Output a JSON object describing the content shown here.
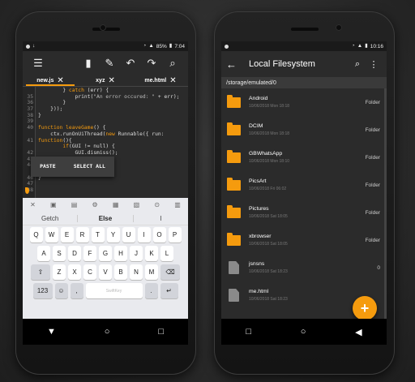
{
  "left": {
    "status": {
      "percent": "85%",
      "time": "7:04"
    },
    "tabs": [
      "new.js",
      "xyz",
      "me.html"
    ],
    "line_numbers": [
      "",
      "35",
      "36",
      "37",
      "38",
      "39",
      "40",
      "",
      "41",
      "",
      "42",
      "43",
      "44",
      "",
      "46",
      "47",
      "48"
    ],
    "code_lines": [
      "        } catch (err) {",
      "            print(\"An error occured: \" + err);",
      "        }",
      "    }));",
      "}",
      "",
      "function leaveGame() {",
      "    ctx.runOnUiThread(new Runnable({ run:",
      "function(){",
      "        if(GUI != null) {",
      "            GUI.dismiss();",
      "",
      "",
      "",
      "}",
      "",
      ""
    ],
    "context_menu": {
      "paste": "PASTE",
      "select_all": "SELECT ALL"
    },
    "keyboard": {
      "suggestions": [
        "Getch",
        "Else",
        "I"
      ],
      "row1": [
        "Q",
        "W",
        "E",
        "R",
        "T",
        "Y",
        "U",
        "I",
        "O",
        "P"
      ],
      "row2": [
        "A",
        "S",
        "D",
        "F",
        "G",
        "H",
        "J",
        "K",
        "L"
      ],
      "row3": [
        "Z",
        "X",
        "C",
        "V",
        "B",
        "N",
        "M"
      ],
      "mode_key": "123",
      "space_label": "SwiftKey"
    }
  },
  "right": {
    "status": {
      "time": "10:16"
    },
    "title": "Local Filesystem",
    "path": "/storage/emulated/0",
    "files": [
      {
        "name": "Android",
        "date": "10/06/2018 Mon 18:18",
        "kind": "Folder",
        "type": "folder"
      },
      {
        "name": "DCIM",
        "date": "10/06/2018 Mon 18:18",
        "kind": "Folder",
        "type": "folder"
      },
      {
        "name": "GBWhatsApp",
        "date": "10/06/2018 Mon 18:10",
        "kind": "Folder",
        "type": "folder"
      },
      {
        "name": "PicsArt",
        "date": "10/06/2018 Fri 06:02",
        "kind": "Folder",
        "type": "folder"
      },
      {
        "name": "Pictures",
        "date": "10/06/2018 Sat 18:05",
        "kind": "Folder",
        "type": "folder"
      },
      {
        "name": "xbrowser",
        "date": "10/06/2018 Sat 18:05",
        "kind": "Folder",
        "type": "folder"
      },
      {
        "name": "jsnsns",
        "date": "10/06/2018 Sat 18:23",
        "kind": "0",
        "type": "file"
      },
      {
        "name": "me.html",
        "date": "10/06/2018 Sat 18:23",
        "kind": "",
        "type": "file"
      }
    ],
    "fab_label": "+"
  },
  "colors": {
    "accent": "#f59b0e",
    "bg": "#2b2b2b"
  }
}
